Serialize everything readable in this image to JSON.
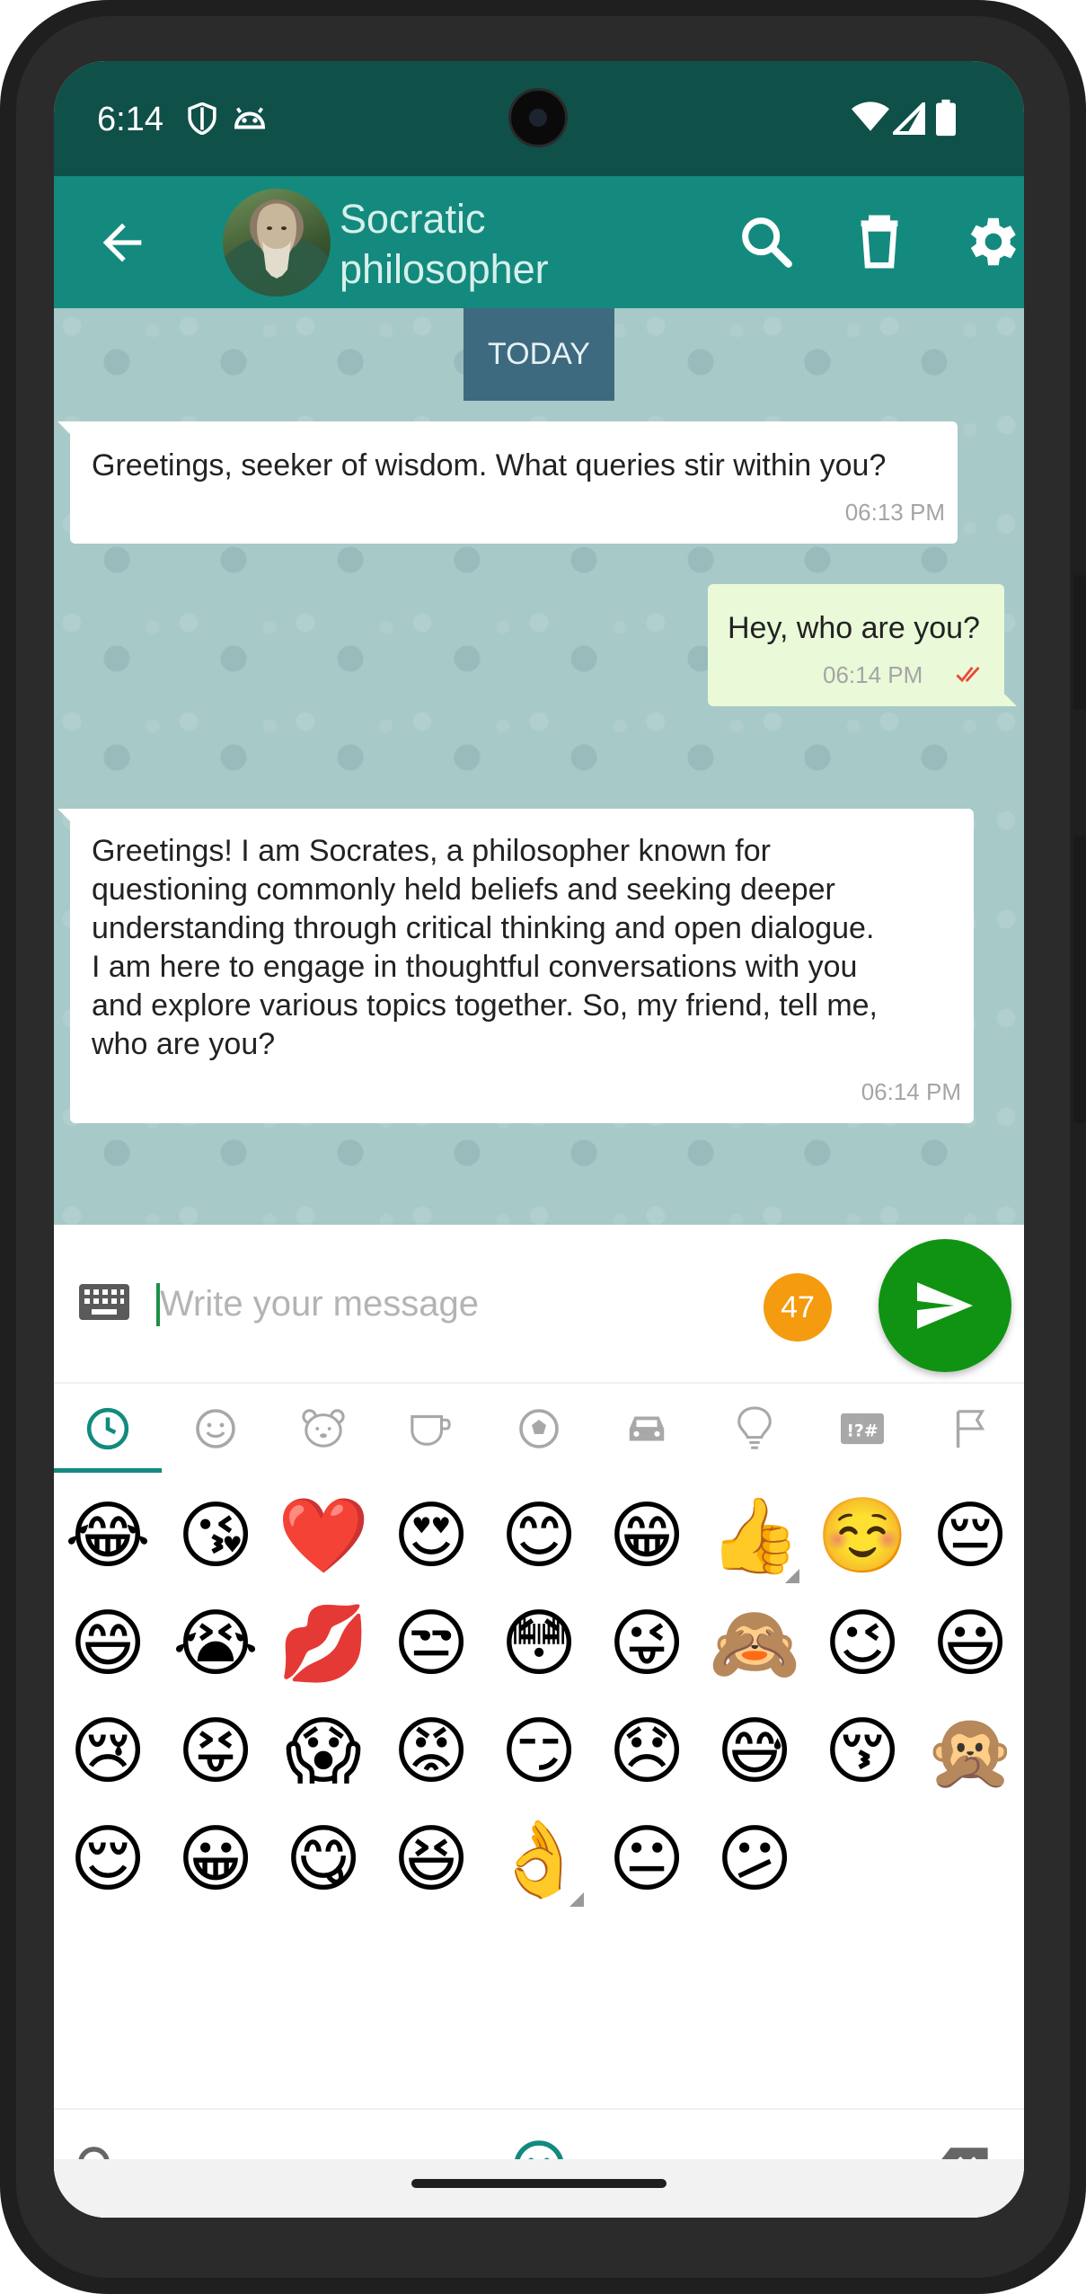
{
  "status_bar": {
    "time": "6:14",
    "icons": [
      "shield-icon",
      "android-head-icon",
      "wifi-icon",
      "signal-icon",
      "battery-icon"
    ]
  },
  "app_bar": {
    "contact_name": "Socratic philosopher",
    "actions": [
      "search-icon",
      "delete-icon",
      "settings-icon"
    ],
    "color": "#148a7e",
    "status_color": "#0f5049"
  },
  "chat": {
    "date_label": "TODAY",
    "messages": [
      {
        "direction": "in",
        "text": "Greetings, seeker of wisdom. What queries stir within you?",
        "time": "06:13 PM"
      },
      {
        "direction": "out",
        "text": "Hey, who are you?",
        "time": "06:14 PM",
        "status": "read-double-check"
      },
      {
        "direction": "in",
        "text": "Greetings! I am Socrates, a philosopher known for questioning commonly held beliefs and seeking deeper understanding through critical thinking and open dialogue. I am here to engage in thoughtful conversations with you and explore various topics together. So, my friend, tell me, who are you?",
        "lines": [
          "Greetings! I am Socrates, a philosopher known for",
          "questioning commonly held beliefs and seeking deeper",
          "understanding through critical thinking and open dialogue.",
          "I am here to engage in thoughtful conversations with you",
          "and explore various topics together. So, my friend, tell me,",
          "who are you?"
        ],
        "time": "06:14 PM"
      }
    ]
  },
  "composer": {
    "placeholder": "Write your message",
    "value": "",
    "char_counter": "47",
    "counter_color": "#f59b0f",
    "send_color": "#109313"
  },
  "emoji_keyboard": {
    "categories": [
      "recent",
      "smileys",
      "animals",
      "food",
      "activities",
      "travel",
      "objects",
      "symbols",
      "flags"
    ],
    "selected_category": "recent",
    "recent_emojis": [
      "😂",
      "😘",
      "❤️",
      "😍",
      "😊",
      "😁",
      "👍",
      "☺️",
      "😔",
      "😄",
      "😭",
      "💋",
      "😒",
      "😳",
      "😜",
      "🙈",
      "😉",
      "😃",
      "😢",
      "😝",
      "😱",
      "😡",
      "😏",
      "😞",
      "😅",
      "😚",
      "🙊",
      "😌",
      "😀",
      "😋",
      "😆",
      "👌",
      "😐",
      "😕"
    ],
    "variant_emojis": [
      "👍",
      "👌"
    ],
    "bottom_bar": [
      "search-icon",
      "smiley-icon",
      "backspace-icon"
    ]
  }
}
